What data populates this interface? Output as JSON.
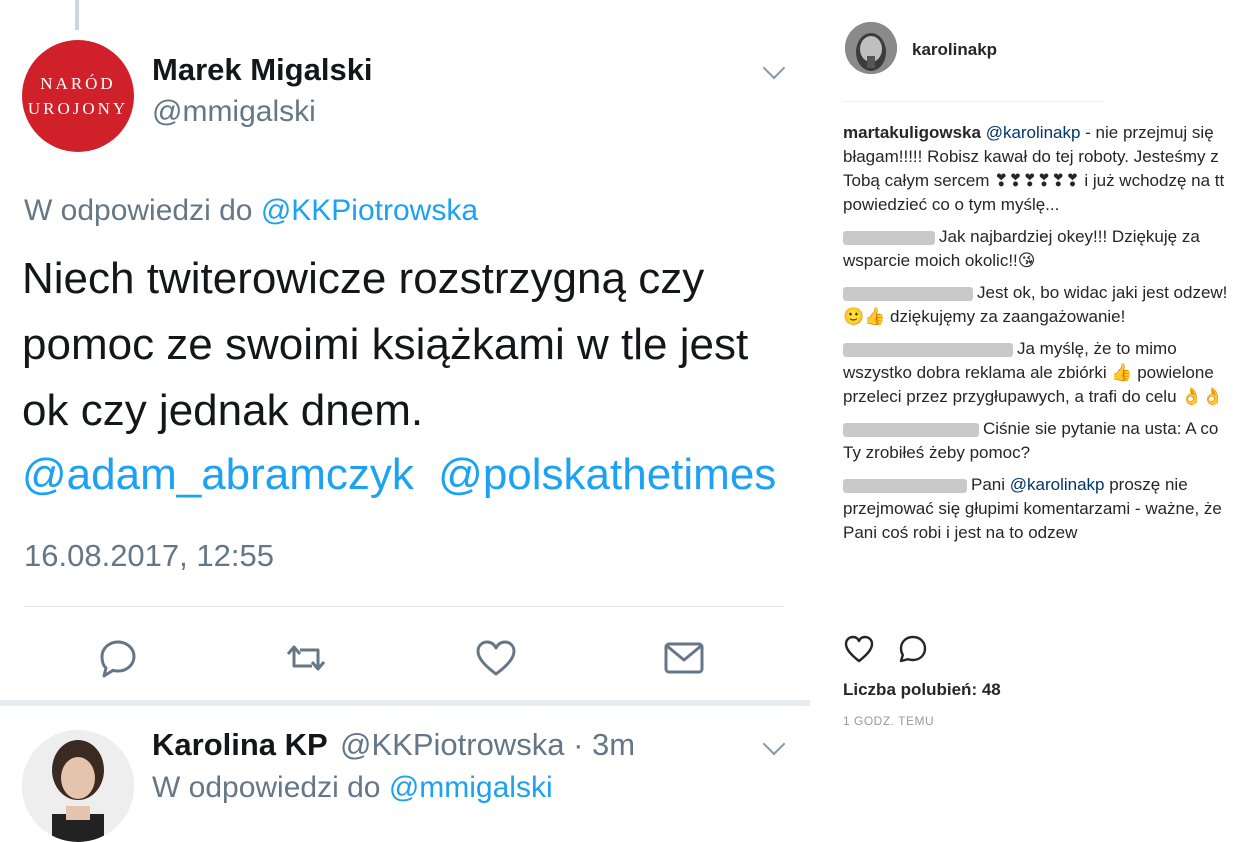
{
  "tweet1": {
    "avatar_line1": "NARÓD",
    "avatar_line2": "UROJONY",
    "name": "Marek Migalski",
    "handle": "@mmigalski",
    "reply_prefix": "W odpowiedzi do",
    "reply_to": "@KKPiotrowska",
    "text": "Niech twiterowicze rozstrzygną czy pomoc ze swoimi książkami w tle jest ok czy jednak dnem.",
    "mentions": [
      "@adam_abramczyk",
      "@polskathetimes"
    ],
    "timestamp": "16.08.2017, 12:55"
  },
  "tweet2": {
    "name": "Karolina KP",
    "handle": "@KKPiotrowska",
    "time": "· 3m",
    "reply_prefix": "W odpowiedzi do",
    "reply_to": "@mmigalski"
  },
  "icons": [
    "reply-icon",
    "retweet-icon",
    "like-icon",
    "direct-message-icon",
    "chevron-down-icon"
  ],
  "instagram": {
    "username": "karolinakp",
    "comments": [
      {
        "user": "martakuligowska",
        "mention": "@karolinakp",
        "text": " - nie przejmuj się błagam!!!!! Robisz kawał do tej roboty. Jesteśmy z Tobą całym sercem ❣❣❣❣❣❣ i już wchodzę na tt powiedzieć co o tym myślę..."
      },
      {
        "user": "",
        "mention": "",
        "text": "Jak najbardziej okey!!! Dziękuję za wsparcie moich okolic!!😘"
      },
      {
        "user": "",
        "mention": "",
        "text": "Jest ok, bo widac jaki jest odzew! 🙂👍 dziękujęmy za zaangażowanie!"
      },
      {
        "user": "",
        "mention": "",
        "text": "Ja myślę, że to mimo wszystko dobra reklama ale zbiórki 👍 powielone przeleci przez przygłupawych, a trafi do celu 👌👌"
      },
      {
        "user": "",
        "mention": "",
        "text": "Ciśnie sie pytanie na usta: A co Ty zrobiłeś żeby pomoc?"
      },
      {
        "user": "",
        "mention": "@karolinakp",
        "pre": "Pani ",
        "text": " proszę nie przejmować się głupimi komentarzami - ważne, że Pani coś robi i jest na to odzew"
      }
    ],
    "likes": "Liczba polubień: 48",
    "time": "1 GODZ. TEMU"
  },
  "colors": {
    "twitter_blue": "#1da1f2",
    "gray": "#657786",
    "avatar_red": "#d0202a"
  }
}
